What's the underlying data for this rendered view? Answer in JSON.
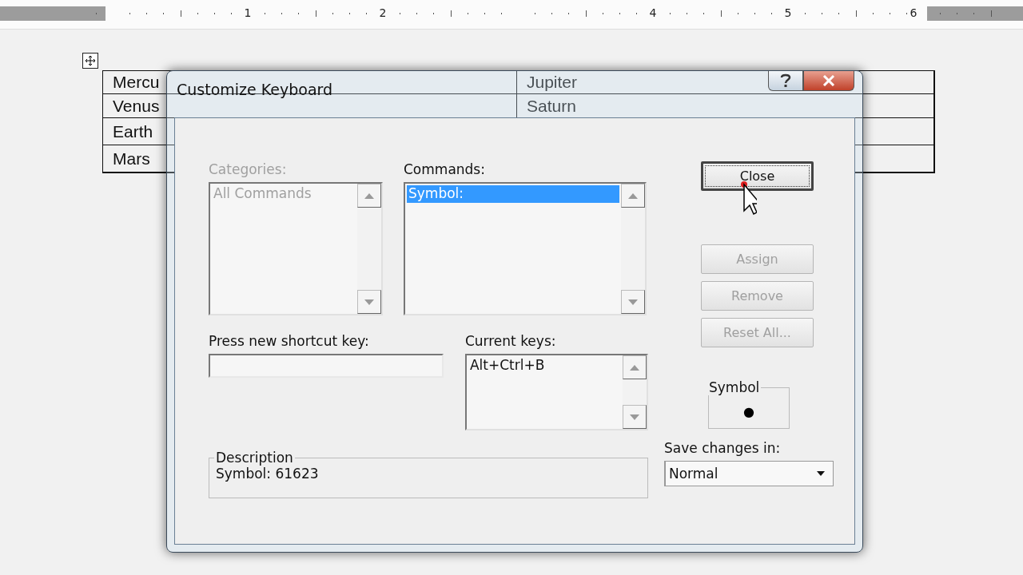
{
  "ruler": {
    "numbers": [
      "1",
      "2",
      "4",
      "5",
      "6"
    ]
  },
  "table": {
    "rows": [
      [
        "Mercu",
        "Jupiter"
      ],
      [
        "Venus",
        "Saturn"
      ],
      [
        "Earth",
        ""
      ],
      [
        "Mars",
        ""
      ]
    ]
  },
  "dialog": {
    "title": "Customize Keyboard",
    "categories": {
      "label": "Categories:",
      "disabled": true,
      "items": [
        {
          "text": "All Commands",
          "selected": false
        }
      ]
    },
    "commands": {
      "label": "Commands:",
      "disabled": false,
      "items": [
        {
          "text": "Symbol:",
          "selected": true
        }
      ]
    },
    "shortcut": {
      "label": "Press new shortcut key:"
    },
    "current_keys": {
      "label": "Current keys:",
      "items": [
        "Alt+Ctrl+B"
      ]
    },
    "description": {
      "label": "Description",
      "text": "Symbol: 61623"
    },
    "buttons": [
      {
        "label": "Close",
        "disabled": false,
        "focused": true
      },
      {
        "label": "Assign",
        "disabled": true,
        "focused": false
      },
      {
        "label": "Remove",
        "disabled": true,
        "focused": false
      },
      {
        "label": "Reset All...",
        "disabled": true,
        "focused": false
      }
    ],
    "symbol_preview": {
      "label": "Symbol",
      "glyph": "●"
    },
    "save_changes": {
      "label": "Save changes in:",
      "value": "Normal"
    }
  }
}
